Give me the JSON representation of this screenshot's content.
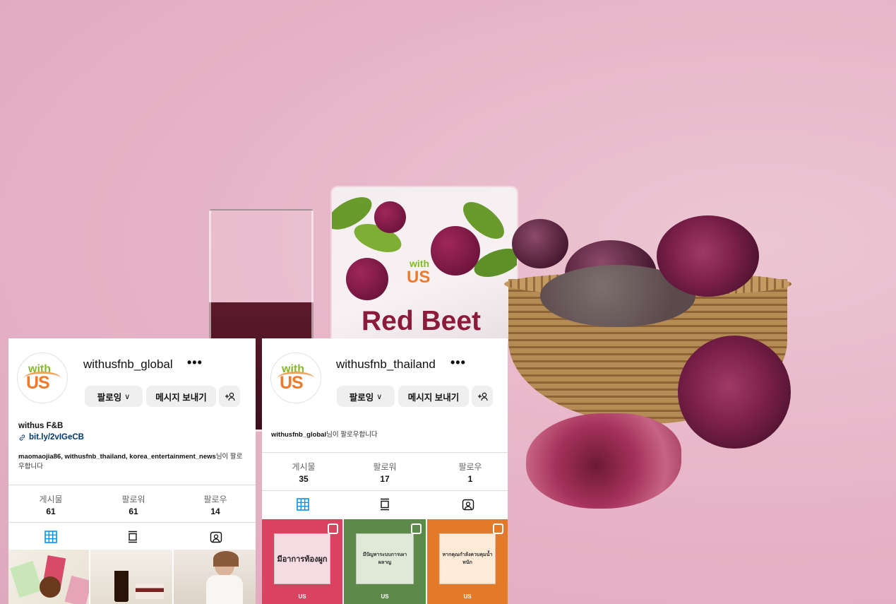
{
  "colors": {
    "accent": "#0095f6",
    "link": "#00376b",
    "button_bg": "#efefef"
  },
  "background": {
    "pouch_brand": "with US",
    "pouch_title": "Red Beet"
  },
  "profiles": [
    {
      "username": "withusfnb_global",
      "buttons": {
        "following": "팔로잉",
        "message": "메시지 보내기"
      },
      "bio_name": "withus F&B",
      "bio_link": "bit.ly/2vIGeCB",
      "followed_by_names": "maomaojia86, withusfnb_thailand, korea_entertainment_news",
      "followed_by_suffix": "님이 팔로우합니다",
      "stats": [
        {
          "label": "게시물",
          "value": "61"
        },
        {
          "label": "팔로워",
          "value": "61"
        },
        {
          "label": "팔로우",
          "value": "14"
        }
      ]
    },
    {
      "username": "withusfnb_thailand",
      "buttons": {
        "following": "팔로잉",
        "message": "메시지 보내기"
      },
      "followed_by_names": "withusfnb_global",
      "followed_by_suffix": "님이 팔로우합니다",
      "stats": [
        {
          "label": "게시물",
          "value": "35"
        },
        {
          "label": "팔로워",
          "value": "17"
        },
        {
          "label": "팔로우",
          "value": "1"
        }
      ],
      "posts": [
        {
          "text": "มีอาการท้องผูก",
          "color": "#d9435f",
          "inner": "#f7dbe3"
        },
        {
          "text": "มีปัญหาระบบการเผาผลาญ",
          "color": "#5d8a4a",
          "inner": "#dfe9d8"
        },
        {
          "text": "หากคุณกำลังควบคุมน้ำหนัก",
          "color": "#e37a2a",
          "inner": "#fdebd7"
        }
      ]
    }
  ],
  "avatar_logo": {
    "top": "with",
    "bottom": "US"
  }
}
